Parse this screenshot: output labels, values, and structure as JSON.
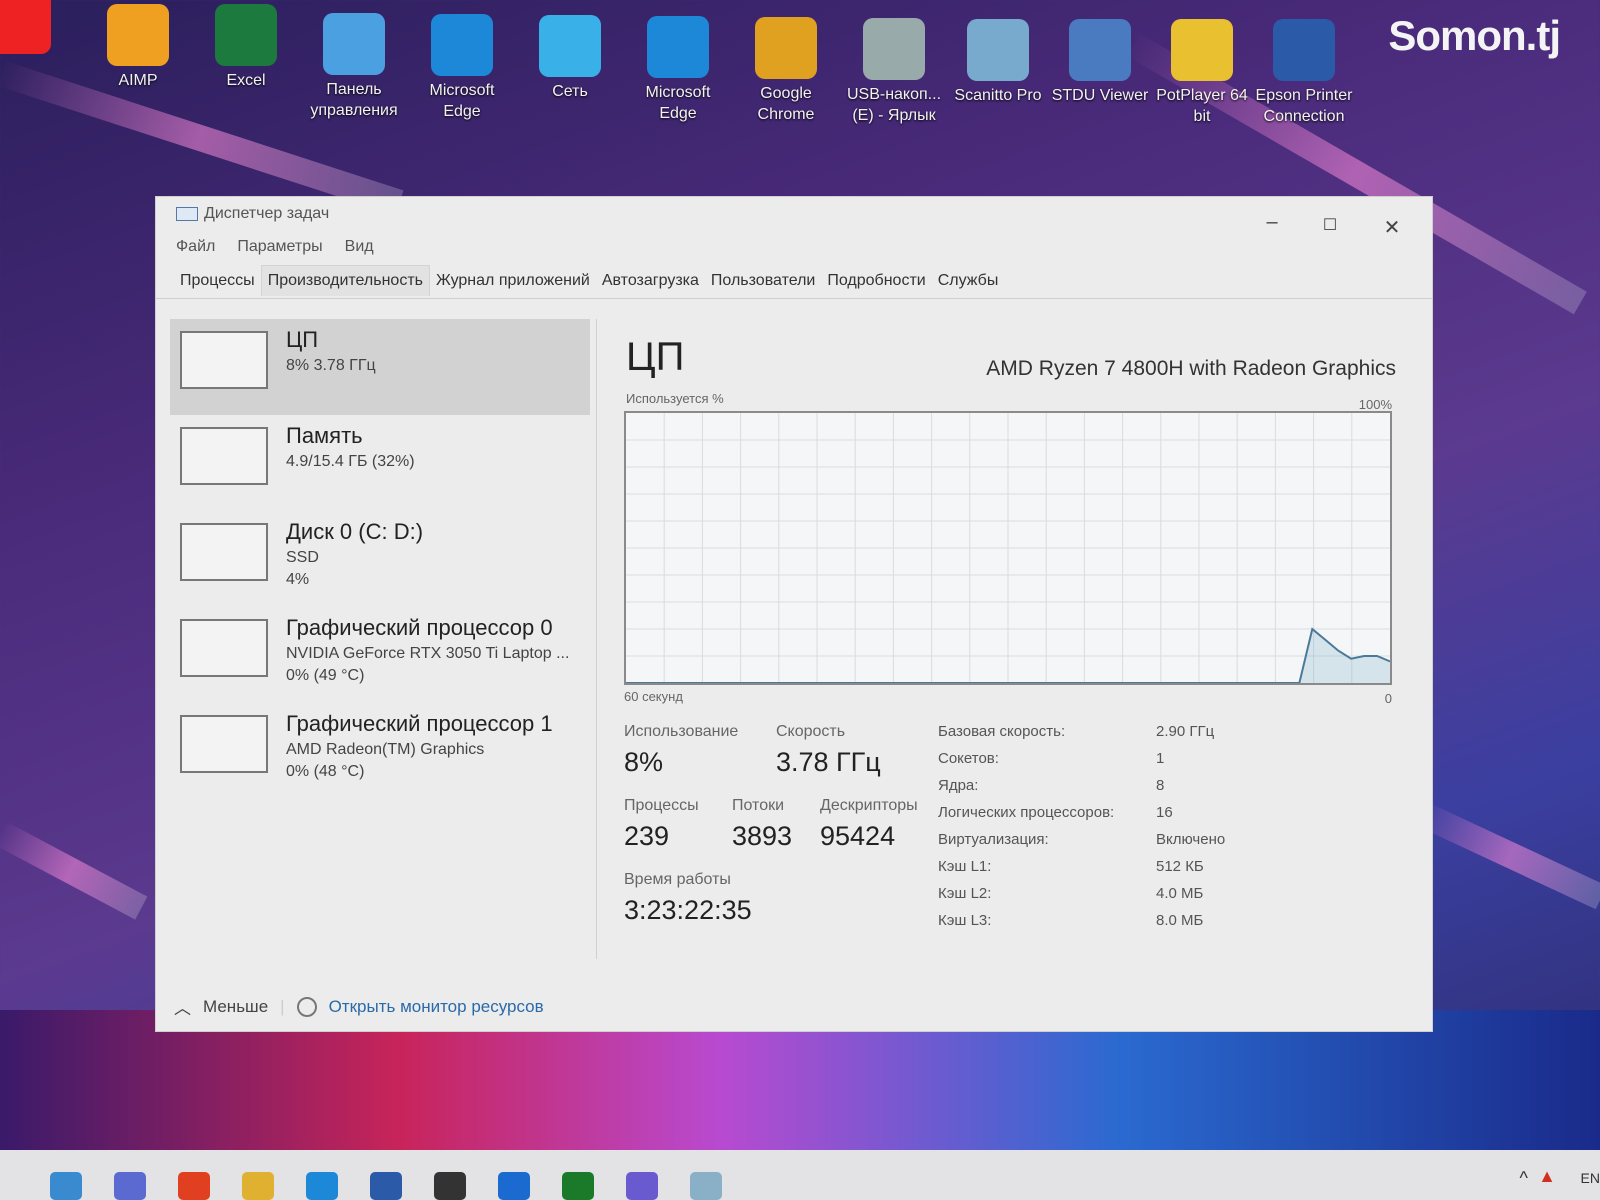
{
  "watermark": "Somon.tj",
  "desktop_icons": [
    {
      "label": "",
      "icon": "yandex-icon",
      "color": "#e22"
    },
    {
      "label": "AIMP",
      "icon": "aimp-icon",
      "color": "#f0a020"
    },
    {
      "label": "Excel",
      "icon": "excel-icon",
      "color": "#1d7a3e"
    },
    {
      "label": "Панель управления",
      "icon": "control-panel-icon",
      "color": "#4aa0e0"
    },
    {
      "label": "Microsoft Edge",
      "icon": "edge-icon",
      "color": "#1e88d8"
    },
    {
      "label": "Сеть",
      "icon": "network-icon",
      "color": "#3ab0e8"
    },
    {
      "label": "Microsoft Edge",
      "icon": "edge-icon",
      "color": "#1e88d8"
    },
    {
      "label": "Google Chrome",
      "icon": "chrome-icon",
      "color": "#e0a020"
    },
    {
      "label": "USB-накоп... (E) - Ярлык",
      "icon": "usb-drive-icon",
      "color": "#9aa"
    },
    {
      "label": "Scanitto Pro",
      "icon": "scanner-icon",
      "color": "#7ac"
    },
    {
      "label": "STDU Viewer",
      "icon": "stdu-viewer-icon",
      "color": "#4a7ac0"
    },
    {
      "label": "PotPlayer 64 bit",
      "icon": "potplayer-icon",
      "color": "#e8c030"
    },
    {
      "label": "Epson Printer Connection",
      "icon": "epson-icon",
      "color": "#2a5aa8"
    }
  ],
  "window": {
    "title": "Диспетчер задач",
    "menu": [
      "Файл",
      "Параметры",
      "Вид"
    ],
    "tabs": [
      "Процессы",
      "Производительность",
      "Журнал приложений",
      "Автозагрузка",
      "Пользователи",
      "Подробности",
      "Службы"
    ],
    "active_tab": "Производительность",
    "resources": [
      {
        "name": "ЦП",
        "sub1": "8% 3.78 ГГц",
        "sub2": ""
      },
      {
        "name": "Память",
        "sub1": "4.9/15.4 ГБ (32%)",
        "sub2": ""
      },
      {
        "name": "Диск 0 (C: D:)",
        "sub1": "SSD",
        "sub2": "4%"
      },
      {
        "name": "Графический процессор 0",
        "sub1": "NVIDIA GeForce RTX 3050 Ti Laptop ...",
        "sub2": "0% (49 °C)"
      },
      {
        "name": "Графический процессор 1",
        "sub1": "AMD Radeon(TM) Graphics",
        "sub2": "0% (48 °C)"
      }
    ],
    "detail": {
      "title": "ЦП",
      "model": "AMD Ryzen 7 4800H with Radeon Graphics",
      "graph_label": "Используется %",
      "graph_max": "100%",
      "graph_time": "60 секунд",
      "graph_min": "0",
      "graph_values": [
        0,
        0,
        0,
        0,
        0,
        0,
        0,
        0,
        0,
        0,
        0,
        0,
        0,
        0,
        0,
        0,
        0,
        0,
        0,
        0,
        0,
        0,
        0,
        0,
        0,
        0,
        0,
        0,
        0,
        0,
        0,
        0,
        0,
        0,
        0,
        0,
        0,
        0,
        0,
        0,
        0,
        0,
        0,
        0,
        0,
        0,
        0,
        0,
        0,
        0,
        0,
        0,
        0,
        20,
        16,
        12,
        9,
        10,
        10,
        8
      ],
      "usage_label": "Использование",
      "usage": "8%",
      "speed_label": "Скорость",
      "speed": "3.78 ГГц",
      "proc_label": "Процессы",
      "proc": "239",
      "threads_label": "Потоки",
      "threads": "3893",
      "handles_label": "Дескрипторы",
      "handles": "95424",
      "uptime_label": "Время работы",
      "uptime": "3:23:22:35",
      "specs": [
        {
          "k": "Базовая скорость:",
          "v": "2.90 ГГц"
        },
        {
          "k": "Сокетов:",
          "v": "1"
        },
        {
          "k": "Ядра:",
          "v": "8"
        },
        {
          "k": "Логических процессоров:",
          "v": "16"
        },
        {
          "k": "Виртуализация:",
          "v": "Включено"
        },
        {
          "k": "Кэш L1:",
          "v": "512 КБ"
        },
        {
          "k": "Кэш L2:",
          "v": "4.0 МБ"
        },
        {
          "k": "Кэш L3:",
          "v": "8.0 МБ"
        }
      ]
    },
    "footer": {
      "less": "Меньше",
      "monitor": "Открыть монитор ресурсов"
    }
  },
  "taskbar": {
    "items": [
      {
        "icon": "task-view-icon",
        "color": "#3a8ad0"
      },
      {
        "icon": "teams-chat-icon",
        "color": "#5a6ad0"
      },
      {
        "icon": "yandex-browser-icon",
        "color": "#e04020"
      },
      {
        "icon": "file-explorer-icon",
        "color": "#e0b030"
      },
      {
        "icon": "edge-icon",
        "color": "#1e88d8"
      },
      {
        "icon": "microsoft-store-icon",
        "color": "#2a5aa8"
      },
      {
        "icon": "app-icon",
        "color": "#333"
      },
      {
        "icon": "app-blue-icon",
        "color": "#1a6ad0"
      },
      {
        "icon": "xbox-icon",
        "color": "#1a7a2a"
      },
      {
        "icon": "app-circle-icon",
        "color": "#6a5ad0"
      },
      {
        "icon": "task-manager-icon",
        "color": "#8ab0c8"
      }
    ],
    "lang": "EN"
  }
}
